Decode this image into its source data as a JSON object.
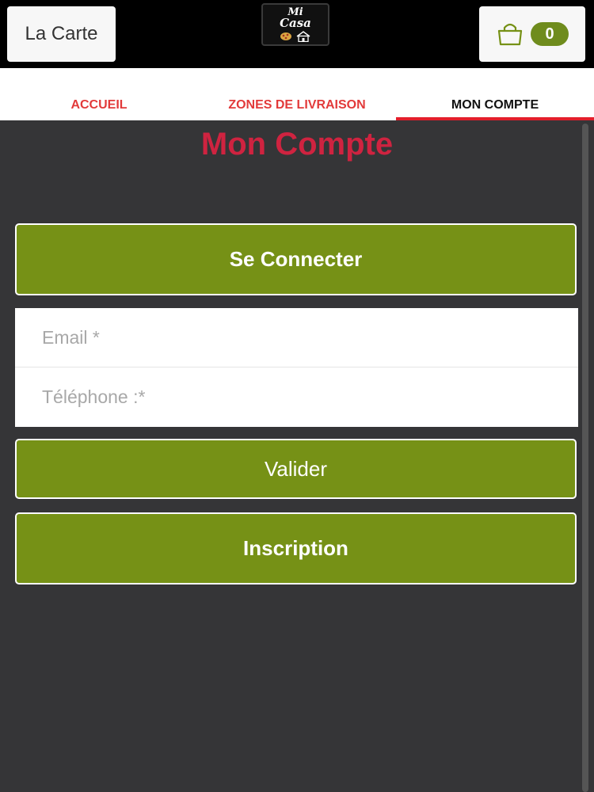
{
  "header": {
    "carte_label": "La Carte",
    "logo_line1": "Mi",
    "logo_line2": "Casa",
    "cart_count": "0"
  },
  "tabs": [
    {
      "label": "ACCUEIL",
      "active": false
    },
    {
      "label": "ZONES DE LIVRAISON",
      "active": false
    },
    {
      "label": "MON COMPTE",
      "active": true
    }
  ],
  "main": {
    "title": "Mon Compte",
    "connect_label": "Se Connecter",
    "email_placeholder": "Email *",
    "phone_placeholder": "Téléphone :*",
    "valider_label": "Valider",
    "inscription_label": "Inscription"
  },
  "colors": {
    "accent_green": "#769116",
    "title_red": "#cf2340",
    "tab_red": "#e23a3a",
    "background": "#353537"
  },
  "icons": [
    "shopping-bag-icon",
    "pizza-icon",
    "house-icon"
  ]
}
